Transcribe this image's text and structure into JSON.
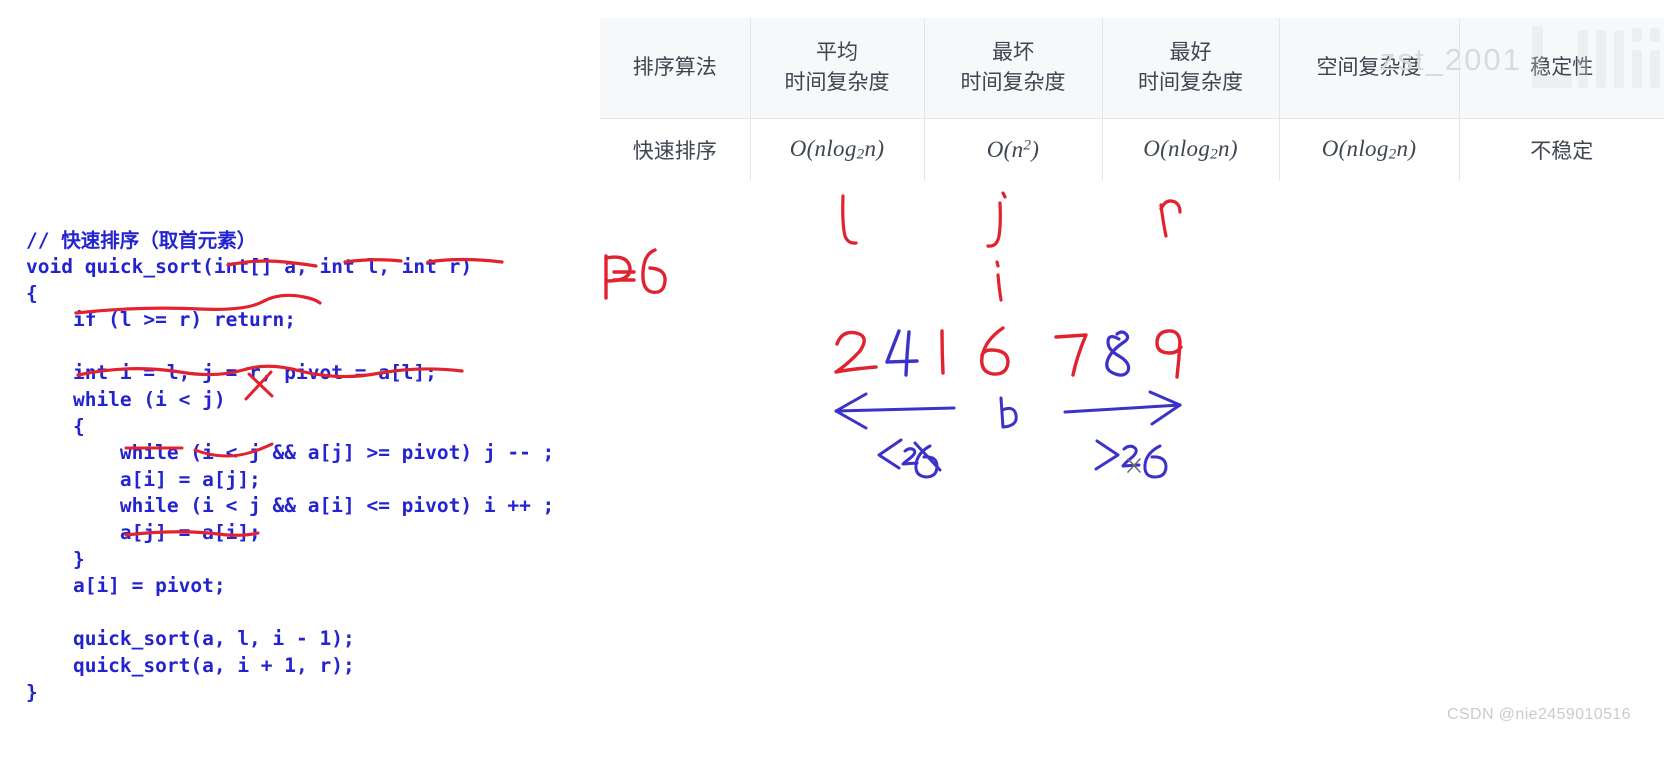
{
  "table": {
    "columns": [
      {
        "key": "algo",
        "lines": [
          "排序算法"
        ]
      },
      {
        "key": "avg",
        "lines": [
          "平均",
          "时间复杂度"
        ]
      },
      {
        "key": "worst",
        "lines": [
          "最坏",
          "时间复杂度"
        ]
      },
      {
        "key": "best",
        "lines": [
          "最好",
          "时间复杂度"
        ]
      },
      {
        "key": "space",
        "lines": [
          "空间复杂度"
        ]
      },
      {
        "key": "stab",
        "lines": [
          "稳定性"
        ]
      }
    ],
    "header": {
      "algo": "排序算法",
      "avg_l1": "平均",
      "avg_l2": "时间复杂度",
      "worst_l1": "最坏",
      "worst_l2": "时间复杂度",
      "best_l1": "最好",
      "best_l2": "时间复杂度",
      "space": "空间复杂度",
      "stability": "稳定性"
    },
    "rows": [
      {
        "algo": "快速排序",
        "avg": "O(nlog₂n)",
        "worst": "O(n²)",
        "best": "O(nlog₂n)",
        "space": "O(nlog₂n)",
        "stability": "不稳定"
      }
    ],
    "row1": {
      "algo": "快速排序",
      "avg_pre": "O(nlog",
      "avg_sub": "2",
      "avg_post": "n)",
      "worst_pre": "O(n",
      "worst_sup": "2",
      "worst_post": ")",
      "best_pre": "O(nlog",
      "best_sub": "2",
      "best_post": "n)",
      "space_pre": "O(nlog",
      "space_sub": "2",
      "space_post": "n)",
      "stability": "不稳定"
    },
    "colors": {
      "header_bg": "#f7f8f9",
      "border": "#e4e6ea",
      "text": "#3f4551"
    }
  },
  "code": {
    "language": "cpp",
    "color": "#2323cf",
    "lines": [
      "// 快速排序（取首元素）",
      "void quick_sort(int[] a, int l, int r)",
      "{",
      "    if (l >= r) return;",
      "",
      "    int i = l, j = r, pivot = a[l];",
      "    while (i < j)",
      "    {",
      "        while (i < j && a[j] >= pivot) j -- ;",
      "        a[i] = a[j];",
      "        while (i < j && a[i] <= pivot) i ++ ;",
      "        a[j] = a[i];",
      "    }",
      "    a[i] = pivot;",
      "",
      "    quick_sort(a, l, i - 1);",
      "    quick_sort(a, i + 1, r);",
      "}"
    ]
  },
  "annotations": {
    "pivot_label": "P=6",
    "pointer_l": "l",
    "pointer_j": "j",
    "pointer_i": "i",
    "pointer_r": "r",
    "array": [
      {
        "value": "2",
        "color": "#e0232e"
      },
      {
        "value": "4",
        "color": "#3b32c8"
      },
      {
        "value": "1",
        "color": "#e0232e"
      },
      {
        "value": "6",
        "color": "#e0232e"
      },
      {
        "value": "7",
        "color": "#e0232e"
      },
      {
        "value": "8",
        "color": "#3b32c8"
      },
      {
        "value": "9",
        "color": "#e0232e"
      }
    ],
    "left_arrow_label": "<6",
    "right_arrow_label": ">6",
    "pivot_mark": "6",
    "colors": {
      "red": "#e0232e",
      "blue": "#3b32c8"
    }
  },
  "watermarks": {
    "bilibili_text": "zst_2001",
    "bilibili_brand": "bilibili",
    "csdn": "CSDN @nie2459010516"
  }
}
